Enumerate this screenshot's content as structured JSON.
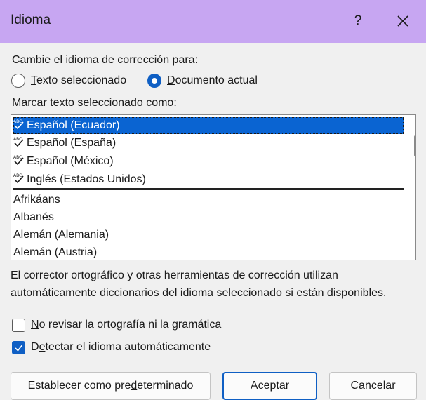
{
  "dialog": {
    "title": "Idioma",
    "help_label": "?"
  },
  "proofing": {
    "label_pre": "Cambie el idioma de corrección para:",
    "option_selected_text": {
      "hotkey": "T",
      "rest": "exto seleccionado",
      "checked": false
    },
    "option_current_doc": {
      "hotkey": "D",
      "rest": "ocumento actual",
      "checked": true
    }
  },
  "mark_as": {
    "hotkey": "M",
    "rest": "arcar texto seleccionado como:"
  },
  "language_list": {
    "recent": [
      {
        "label": "Español (Ecuador)",
        "selected": true
      },
      {
        "label": "Español (España)",
        "selected": false
      },
      {
        "label": "Español (México)",
        "selected": false
      },
      {
        "label": "Inglés (Estados Unidos)",
        "selected": false
      }
    ],
    "all": [
      "Afrikáans",
      "Albanés",
      "Alemán (Alemania)",
      "Alemán (Austria)"
    ]
  },
  "info_text": {
    "line1": "El corrector ortográfico y otras herramientas de corrección utilizan",
    "line2": "automáticamente diccionarios del idioma seleccionado si están disponibles."
  },
  "options": {
    "no_check": {
      "hotkey": "N",
      "rest": "o revisar la ortografía ni la gramática",
      "checked": false
    },
    "detect": {
      "pre": "D",
      "hotkey": "e",
      "rest": "tectar el idioma automáticamente",
      "checked": true
    }
  },
  "buttons": {
    "set_default": {
      "pre": "Establecer como pre",
      "hotkey": "d",
      "rest": "eterminado"
    },
    "ok": "Aceptar",
    "cancel": "Cancelar"
  },
  "colors": {
    "titlebar": "#c7a6f2",
    "accent": "#0f5fc4",
    "selection": "#0a64d2"
  }
}
